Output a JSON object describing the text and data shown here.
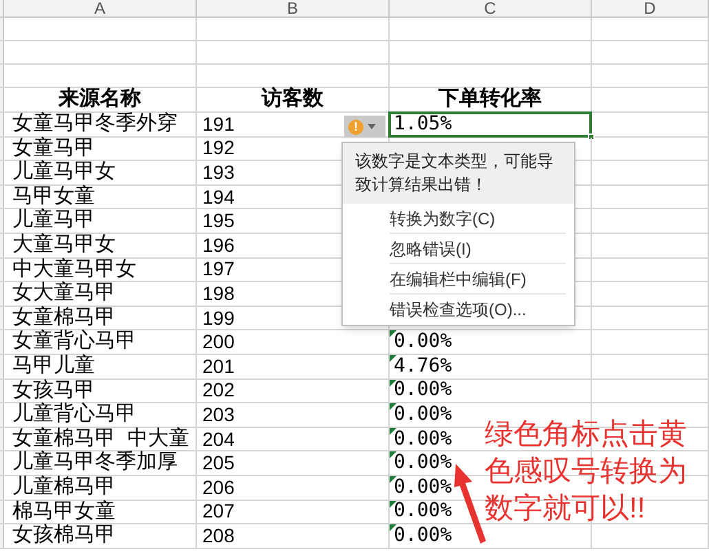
{
  "columns": [
    "A",
    "B",
    "C",
    "D"
  ],
  "header_row": [
    "来源名称",
    "访客数",
    "下单转化率"
  ],
  "rows": [
    {
      "name": "女童马甲冬季外穿",
      "visitors": "191",
      "rate": "1.05%",
      "selected": true,
      "text_number_flag": false
    },
    {
      "name": "女童马甲",
      "visitors": "192",
      "selected": false,
      "text_number_flag": false
    },
    {
      "name": "儿童马甲女",
      "visitors": "193",
      "selected": false,
      "text_number_flag": false
    },
    {
      "name": "马甲女童",
      "visitors": "194",
      "selected": false,
      "text_number_flag": false
    },
    {
      "name": "儿童马甲",
      "visitors": "195",
      "selected": false,
      "text_number_flag": false
    },
    {
      "name": "大童马甲女",
      "visitors": "196",
      "selected": false,
      "text_number_flag": false
    },
    {
      "name": "中大童马甲女",
      "visitors": "197",
      "selected": false,
      "text_number_flag": false
    },
    {
      "name": "女大童马甲",
      "visitors": "198",
      "selected": false,
      "text_number_flag": false
    },
    {
      "name": "女童棉马甲",
      "visitors": "199",
      "selected": false,
      "text_number_flag": false
    },
    {
      "name": "女童背心马甲",
      "visitors": "200",
      "rate": "0.00%",
      "selected": false,
      "text_number_flag": true
    },
    {
      "name": "马甲儿童",
      "visitors": "201",
      "rate": "4.76%",
      "selected": false,
      "text_number_flag": true
    },
    {
      "name": "女孩马甲",
      "visitors": "202",
      "rate": "0.00%",
      "selected": false,
      "text_number_flag": true
    },
    {
      "name": "儿童背心马甲",
      "visitors": "203",
      "rate": "0.00%",
      "selected": false,
      "text_number_flag": true
    },
    {
      "name": "女童棉马甲  中大童",
      "visitors": "204",
      "rate": "0.00%",
      "selected": false,
      "text_number_flag": true
    },
    {
      "name": "儿童马甲冬季加厚",
      "visitors": "205",
      "rate": "0.00%",
      "selected": false,
      "text_number_flag": true
    },
    {
      "name": "儿童棉马甲",
      "visitors": "206",
      "rate": "0.00%",
      "selected": false,
      "text_number_flag": true
    },
    {
      "name": "棉马甲女童",
      "visitors": "207",
      "rate": "0.00%",
      "selected": false,
      "text_number_flag": true
    },
    {
      "name": "女孩棉马甲",
      "visitors": "208",
      "rate": "0.00%",
      "selected": false,
      "text_number_flag": true
    }
  ],
  "error_button": {
    "symbol": "!"
  },
  "error_popup": {
    "message": "该数字是文本类型，可能导致计算结果出错！",
    "items": [
      "转换为数字(C)",
      "忽略错误(I)",
      "在编辑栏中编辑(F)",
      "错误检查选项(O)..."
    ]
  },
  "annotation": {
    "text": "绿色角标点击黄色感叹号转换为数字就可以!!"
  }
}
